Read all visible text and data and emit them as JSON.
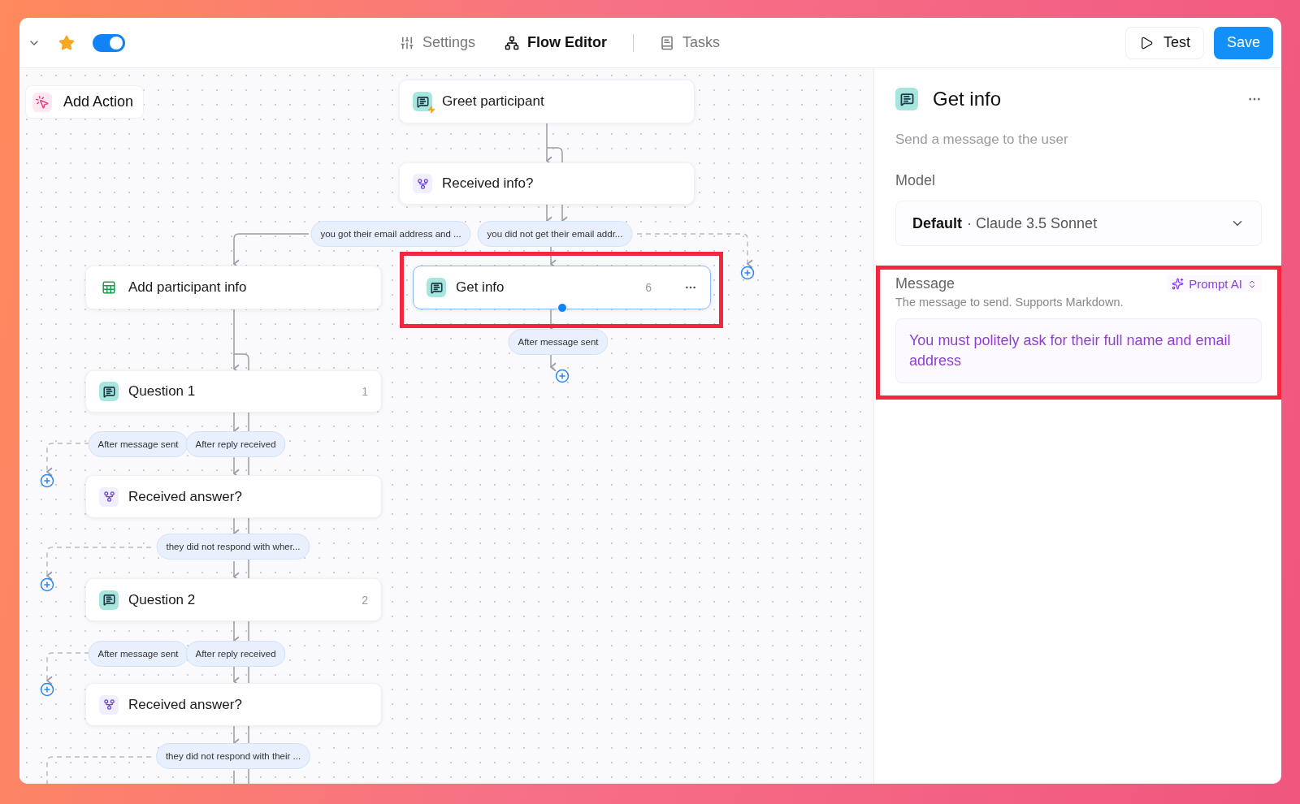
{
  "topbar": {
    "starred": true,
    "enabled": true,
    "tabs": [
      {
        "label": "Settings",
        "selected": false
      },
      {
        "label": "Flow Editor",
        "selected": true
      },
      {
        "label": "Tasks",
        "selected": false
      }
    ],
    "test_button": "Test",
    "save_button": "Save"
  },
  "canvas": {
    "add_action": "Add Action",
    "nodes": [
      {
        "kind": "trigger",
        "label": "Greet participant",
        "selected": false,
        "highlighted": false
      },
      {
        "kind": "branch",
        "label": "Received info?",
        "selected": false,
        "highlighted": false
      },
      {
        "kind": "sheet",
        "label": "Add participant info",
        "selected": false,
        "highlighted": false
      },
      {
        "kind": "message",
        "label": "Get info",
        "badge": "6",
        "selected": true,
        "highlighted": true
      },
      {
        "kind": "message",
        "label": "Question 1",
        "badge": "1",
        "selected": false,
        "highlighted": false
      },
      {
        "kind": "branch",
        "label": "Received answer?",
        "selected": false,
        "highlighted": false
      },
      {
        "kind": "message",
        "label": "Question 2",
        "badge": "2",
        "selected": false,
        "highlighted": false
      },
      {
        "kind": "branch",
        "label": "Received answer?",
        "selected": false,
        "highlighted": false
      }
    ],
    "edge_labels": [
      "you got their email address and ...",
      "you did not get their email addr...",
      "After message sent",
      "After message sent",
      "After reply received",
      "they did not respond with wher...",
      "After message sent",
      "After reply received",
      "they did not respond with their ..."
    ]
  },
  "panel": {
    "title": "Get info",
    "description": "Send a message to the user",
    "model_label": "Model",
    "model_value": "Default",
    "model_detail": "· Claude 3.5 Sonnet",
    "message": {
      "label": "Message",
      "prompt_button": "Prompt AI",
      "hint": "The message to send. Supports Markdown.",
      "value": "You must politely ask for their full name and email address",
      "highlighted": true
    }
  }
}
